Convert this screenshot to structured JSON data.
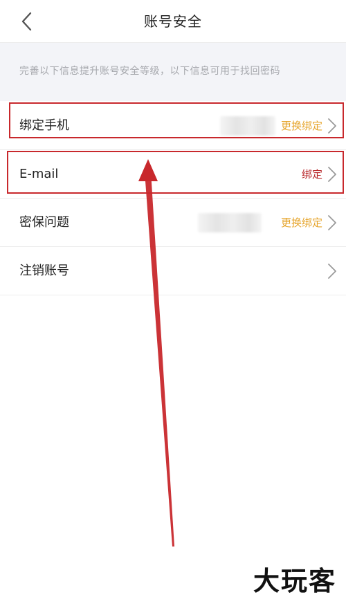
{
  "header": {
    "title": "账号安全",
    "back_icon": "chevron-left-icon"
  },
  "hint": {
    "text": "完善以下信息提升账号安全等级，以下信息可用于找回密码"
  },
  "rows": [
    {
      "label": "绑定手机",
      "action": "更换绑定",
      "action_color": "#e6a42a",
      "masked": true,
      "highlighted": true
    },
    {
      "label": "E-mail",
      "action": "绑定",
      "action_color": "#b8262a",
      "masked": false,
      "highlighted": true
    },
    {
      "label": "密保问题",
      "action": "更换绑定",
      "action_color": "#e6a42a",
      "masked": true,
      "highlighted": false
    },
    {
      "label": "注销账号",
      "action": "",
      "masked": false,
      "highlighted": false
    }
  ],
  "colors": {
    "accent_gold": "#e6a42a",
    "accent_red": "#b8262a",
    "highlight_red": "#c8282c",
    "hint_bg": "#f3f4f8",
    "hint_text": "#a6a8ad"
  },
  "watermark": {
    "text": "大玩客"
  }
}
